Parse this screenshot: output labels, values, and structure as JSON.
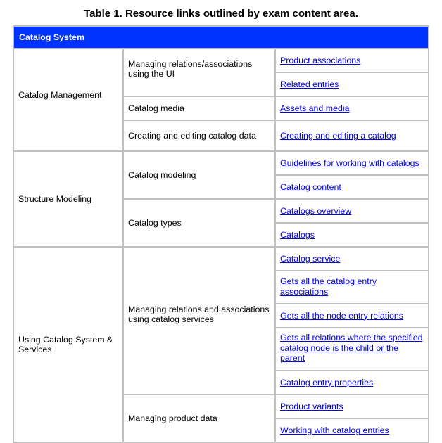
{
  "caption": "Table 1. Resource links outlined by exam content area.",
  "table": {
    "header": "Catalog System",
    "accent_color": "#0033ff",
    "link_color": "#0000ee",
    "areas": [
      {
        "name": "Catalog Management",
        "topics": [
          {
            "name": "Managing relations/associations using the UI",
            "links": [
              "Product associations",
              "Related entries"
            ]
          },
          {
            "name": "Catalog media",
            "links": [
              "Assets and media"
            ]
          },
          {
            "name": "Creating and editing catalog data",
            "links": [
              "Creating and editing a catalog"
            ]
          }
        ]
      },
      {
        "name": "Structure Modeling",
        "topics": [
          {
            "name": "Catalog modeling",
            "links": [
              "Guidelines for working with catalogs",
              "Catalog content"
            ]
          },
          {
            "name": "Catalog types",
            "links": [
              "Catalogs overview",
              "Catalogs"
            ]
          }
        ]
      },
      {
        "name": "Using Catalog System & Services",
        "topics": [
          {
            "name": "Managing relations and associations using catalog services",
            "links": [
              "Catalog service",
              "Gets all the catalog entry associations",
              "Gets all the node entry relations",
              "Gets all relations where the specified catalog node is the child or the parent",
              "Catalog entry properties"
            ]
          },
          {
            "name": "Managing product data",
            "links": [
              "Product variants",
              "Working with catalog entries"
            ]
          }
        ]
      }
    ]
  }
}
